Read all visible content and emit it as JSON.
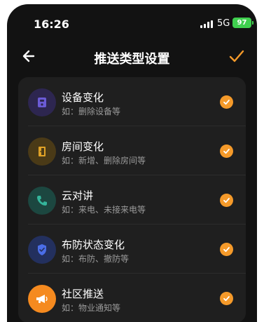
{
  "status_bar": {
    "time": "16:26",
    "network": "5G",
    "battery": "97"
  },
  "nav": {
    "title": "推送类型设置"
  },
  "colors": {
    "accent": "#f59a2a",
    "background": "#121212",
    "card": "#1f1f1f"
  },
  "items": [
    {
      "title": "设备变化",
      "subtitle": "如：删除设备等",
      "icon": "device-icon",
      "icon_bg": "#2d2650",
      "icon_color": "#6b5bd6",
      "checked": true
    },
    {
      "title": "房间变化",
      "subtitle": "如：新增、删除房间等",
      "icon": "door-icon",
      "icon_bg": "#4a3a17",
      "icon_color": "#e0a227",
      "checked": true
    },
    {
      "title": "云对讲",
      "subtitle": "如：来电、未接来电等",
      "icon": "phone-icon",
      "icon_bg": "#1c4740",
      "icon_color": "#34b59b",
      "checked": true
    },
    {
      "title": "布防状态变化",
      "subtitle": "如：布防、撤防等",
      "icon": "shield-icon",
      "icon_bg": "#23305e",
      "icon_color": "#4b6ee8",
      "checked": true
    },
    {
      "title": "社区推送",
      "subtitle": "如：物业通知等",
      "icon": "megaphone-icon",
      "icon_bg": "#f58a1f",
      "icon_color": "#ffffff",
      "checked": true
    }
  ]
}
